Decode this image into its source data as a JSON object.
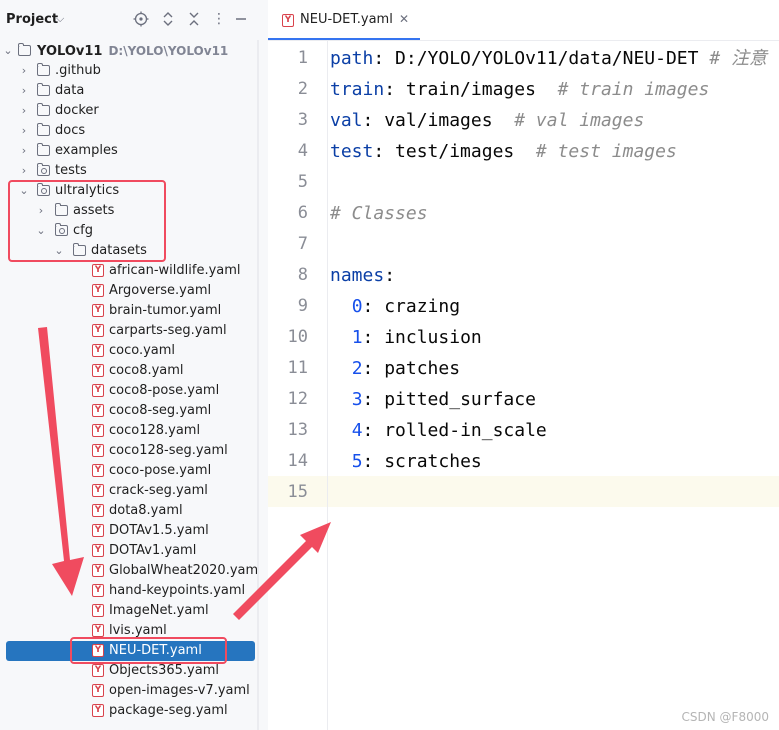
{
  "project": {
    "title": "Project",
    "root": {
      "name": "YOLOv11",
      "path": "D:\\YOLO\\YOLOv11"
    },
    "folders": [
      ".github",
      "data",
      "docker",
      "docs",
      "examples",
      "tests"
    ],
    "ultralytics": "ultralytics",
    "assets": "assets",
    "cfg": "cfg",
    "datasets": "datasets",
    "files": [
      "african-wildlife.yaml",
      "Argoverse.yaml",
      "brain-tumor.yaml",
      "carparts-seg.yaml",
      "coco.yaml",
      "coco8.yaml",
      "coco8-pose.yaml",
      "coco8-seg.yaml",
      "coco128.yaml",
      "coco128-seg.yaml",
      "coco-pose.yaml",
      "crack-seg.yaml",
      "dota8.yaml",
      "DOTAv1.5.yaml",
      "DOTAv1.yaml",
      "GlobalWheat2020.yaml",
      "hand-keypoints.yaml",
      "ImageNet.yaml",
      "lvis.yaml",
      "NEU-DET.yaml",
      "Objects365.yaml",
      "open-images-v7.yaml",
      "package-seg.yaml"
    ],
    "selected_file": "NEU-DET.yaml"
  },
  "editor": {
    "tab_label": "NEU-DET.yaml",
    "lines": [
      {
        "n": "1",
        "key": "path",
        "value": " D:/YOLO/YOLOv11/data/NEU-DET ",
        "comment": "# 注意"
      },
      {
        "n": "2",
        "key": "train",
        "value": " train/images  ",
        "comment": "# train images"
      },
      {
        "n": "3",
        "key": "val",
        "value": " val/images  ",
        "comment": "# val images"
      },
      {
        "n": "4",
        "key": "test",
        "value": " test/images  ",
        "comment": "# test images"
      },
      {
        "n": "5"
      },
      {
        "n": "6",
        "comment": "# Classes"
      },
      {
        "n": "7"
      },
      {
        "n": "8",
        "key": "names",
        "value": ""
      },
      {
        "n": "9",
        "idx": "0",
        "value": " crazing"
      },
      {
        "n": "10",
        "idx": "1",
        "value": " inclusion"
      },
      {
        "n": "11",
        "idx": "2",
        "value": " patches"
      },
      {
        "n": "12",
        "idx": "3",
        "value": " pitted_surface"
      },
      {
        "n": "13",
        "idx": "4",
        "value": " rolled-in_scale"
      },
      {
        "n": "14",
        "idx": "5",
        "value": " scratches"
      },
      {
        "n": "15"
      }
    ]
  },
  "watermark": "CSDN @F8000",
  "colors": {
    "selection": "#2675bf",
    "annotation": "#f04b5f",
    "keyword": "#0b3fa6",
    "comment": "#8c8c8c"
  }
}
